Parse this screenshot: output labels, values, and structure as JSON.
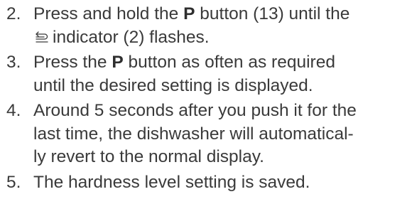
{
  "steps": [
    {
      "number": "2.",
      "line1_pre": "Press and hold the ",
      "line1_bold": "P",
      "line1_post": " button (13) until the",
      "line2_text": "indicator (2) flashes.",
      "icon": "water-softener-icon"
    },
    {
      "number": "3.",
      "line1_pre": "Press the ",
      "line1_bold": "P",
      "line1_post": " button as often as required",
      "line2_text": "until the desired setting is displayed."
    },
    {
      "number": "4.",
      "line1": "Around 5 seconds after you push it for the",
      "line2": "last time, the dishwasher will automatical-",
      "line3": "ly revert to the normal display."
    },
    {
      "number": "5.",
      "line1": "The hardness level setting is saved."
    }
  ]
}
